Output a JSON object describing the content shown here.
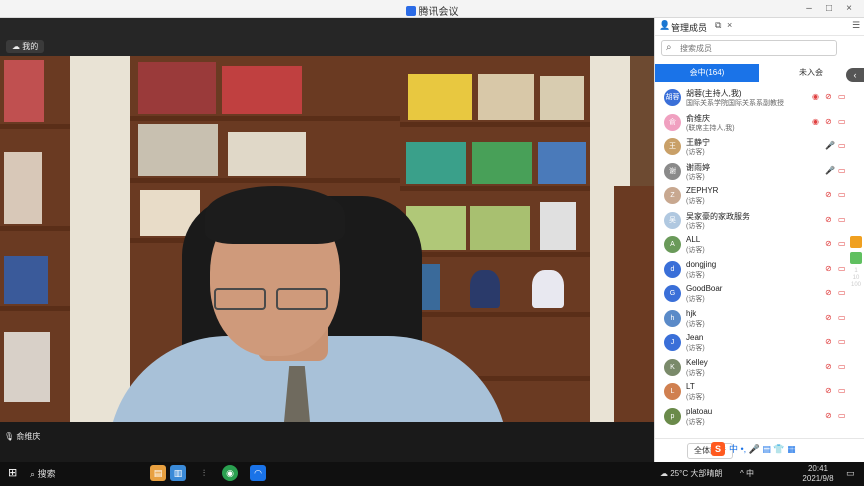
{
  "window": {
    "title": "腾讯会议",
    "controls": [
      "–",
      "□",
      "×"
    ]
  },
  "video": {
    "self_label": "我的",
    "speaker_label": "俞维庆"
  },
  "panel": {
    "title": "管理成员",
    "search_placeholder": "搜索成员",
    "tab_active": "会中(164)",
    "tab_inactive": "未入会",
    "footer_button": "全体静音"
  },
  "participants": [
    {
      "name": "胡蓉(主持人,我)",
      "role": "国际关系学院国际关系系副教授",
      "avatar": "胡蓉",
      "color": "#3a6fd8",
      "icons": [
        "eye-icon",
        "mic-off-icon",
        "camera-off-icon"
      ]
    },
    {
      "name": "俞维庆",
      "role": "(联席主持人,我)",
      "avatar": "俞",
      "color": "#f0a0c0",
      "icons": [
        "eye-icon",
        "mic-off-icon",
        "camera-off-icon"
      ]
    },
    {
      "name": "王静宁",
      "role": "(访客)",
      "avatar": "王",
      "color": "#c9a068",
      "icons": [
        "mic-on-icon",
        "camera-off-icon"
      ]
    },
    {
      "name": "谢雨婷",
      "role": "(访客)",
      "avatar": "谢",
      "color": "#8a8a8a",
      "icons": [
        "mic-on-icon",
        "camera-off-icon"
      ]
    },
    {
      "name": "ZEPHYR",
      "role": "(访客)",
      "avatar": "Z",
      "color": "#c8a890",
      "icons": [
        "mic-off-icon",
        "camera-off-icon"
      ]
    },
    {
      "name": "吴家豪的家政服务",
      "role": "(访客)",
      "avatar": "吴",
      "color": "#b0c8e0",
      "icons": [
        "mic-off-icon",
        "camera-off-icon"
      ]
    },
    {
      "name": "ALL",
      "role": "(访客)",
      "avatar": "A",
      "color": "#6a9a5a",
      "icons": [
        "mic-off-icon",
        "camera-off-icon"
      ]
    },
    {
      "name": "dongjing",
      "role": "(访客)",
      "avatar": "d",
      "color": "#3a6fd8",
      "icons": [
        "mic-off-icon",
        "camera-off-icon"
      ]
    },
    {
      "name": "GoodBoar",
      "role": "(访客)",
      "avatar": "G",
      "color": "#3a6fd8",
      "icons": [
        "mic-off-icon",
        "camera-off-icon"
      ]
    },
    {
      "name": "hjk",
      "role": "(访客)",
      "avatar": "h",
      "color": "#5a8ac8",
      "icons": [
        "mic-off-icon",
        "camera-off-icon"
      ]
    },
    {
      "name": "Jean",
      "role": "(访客)",
      "avatar": "J",
      "color": "#3a6fd8",
      "icons": [
        "mic-off-icon",
        "camera-off-icon"
      ]
    },
    {
      "name": "Kelley",
      "role": "(访客)",
      "avatar": "K",
      "color": "#7a8a6a",
      "icons": [
        "mic-off-icon",
        "camera-off-icon"
      ]
    },
    {
      "name": "LT",
      "role": "(访客)",
      "avatar": "L",
      "color": "#d08050",
      "icons": [
        "mic-off-icon",
        "camera-off-icon"
      ]
    },
    {
      "name": "platoau",
      "role": "(访客)",
      "avatar": "p",
      "color": "#6a8a4a",
      "icons": [
        "mic-off-icon",
        "camera-off-icon"
      ]
    }
  ],
  "taskbar": {
    "search_label": "搜索",
    "weather": "25°C 大部晴朗",
    "tray": "^ 中",
    "time": "20:41",
    "date": "2021/9/8"
  },
  "side_stats": [
    "1",
    "10",
    "100"
  ]
}
